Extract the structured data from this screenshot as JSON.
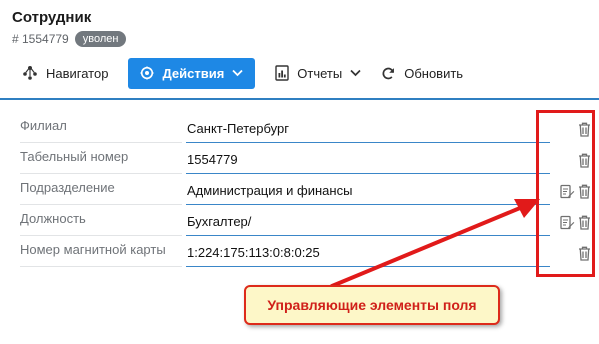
{
  "header": {
    "title": "Сотрудник",
    "id_text": "# 1554779",
    "status_badge": "уволен"
  },
  "toolbar": {
    "navigator_label": "Навигатор",
    "actions_label": "Действия",
    "reports_label": "Отчеты",
    "refresh_label": "Обновить"
  },
  "fields": [
    {
      "label": "Филиал",
      "value": "Санкт-Петербург",
      "controls": [
        "trash-icon"
      ]
    },
    {
      "label": "Табельный номер",
      "value": "1554779",
      "controls": [
        "trash-icon"
      ]
    },
    {
      "label": "Подразделение",
      "value": "Администрация и финансы",
      "controls": [
        "edit-icon",
        "trash-icon"
      ]
    },
    {
      "label": "Должность",
      "value": "Бухгалтер/",
      "controls": [
        "edit-icon",
        "trash-icon"
      ]
    },
    {
      "label": "Номер магнитной карты",
      "value": "1:224:175:113:0:8:0:25",
      "controls": [
        "trash-icon"
      ]
    }
  ],
  "annotation": {
    "callout_text": "Управляющие элементы поля"
  },
  "colors": {
    "primary": "#1e88e5",
    "badge": "#72787e",
    "annotation_red": "#e11a1a",
    "callout_bg": "#fdf7c8"
  }
}
